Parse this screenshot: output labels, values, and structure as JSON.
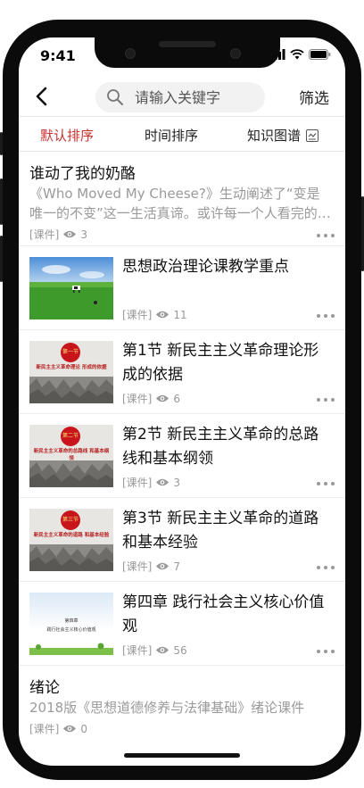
{
  "status": {
    "time": "9:41"
  },
  "search": {
    "placeholder": "请输入关键字"
  },
  "header": {
    "filter_label": "筛选"
  },
  "tabs": [
    {
      "label": "默认排序",
      "active": true
    },
    {
      "label": "时间排序",
      "active": false
    },
    {
      "label": "知识图谱",
      "active": false
    }
  ],
  "items": [
    {
      "title": "谁动了我的奶酪",
      "desc": "《Who Moved My Cheese?》生动阐述了“变是唯一的不变”这一生活真谛。或许每一个人看完的…",
      "tag": "[课件]",
      "views": "3"
    },
    {
      "title": "思想政治理论课教学重点",
      "tag": "[课件]",
      "views": "11",
      "thumb": "cow-field"
    },
    {
      "title": "第1节  新民主主义革命理论形成的依据",
      "tag": "[课件]",
      "views": "6",
      "thumb": "relief-slide",
      "badge": "第一节",
      "slide_text": "新民主主义革命理论 形成的依据"
    },
    {
      "title": "第2节  新民主主义革命的总路线和基本纲领",
      "tag": "[课件]",
      "views": "3",
      "thumb": "relief-slide",
      "badge": "第二节",
      "slide_text": "新民主主义革命的总路线 和基本纲领"
    },
    {
      "title": "第3节  新民主主义革命的道路和基本经验",
      "tag": "[课件]",
      "views": "7",
      "thumb": "relief-slide",
      "badge": "第三节",
      "slide_text": "新民主主义革命的道路 和基本经验"
    },
    {
      "title": "第四章 践行社会主义核心价值观",
      "tag": "[课件]",
      "views": "56",
      "thumb": "blue-slide",
      "slide_title": "第四章",
      "slide_text": "践行社会主义核心价值观"
    },
    {
      "title": "绪论",
      "desc": "2018版《思想道德修养与法律基础》绪论课件",
      "tag": "[课件]",
      "views": "0"
    }
  ],
  "colors": {
    "accent": "#c8312e",
    "muted": "#999999"
  },
  "icons": [
    "back-arrow-icon",
    "search-icon",
    "signal-icon",
    "wifi-icon",
    "battery-icon",
    "knowledge-graph-icon",
    "eye-icon",
    "more-icon"
  ]
}
